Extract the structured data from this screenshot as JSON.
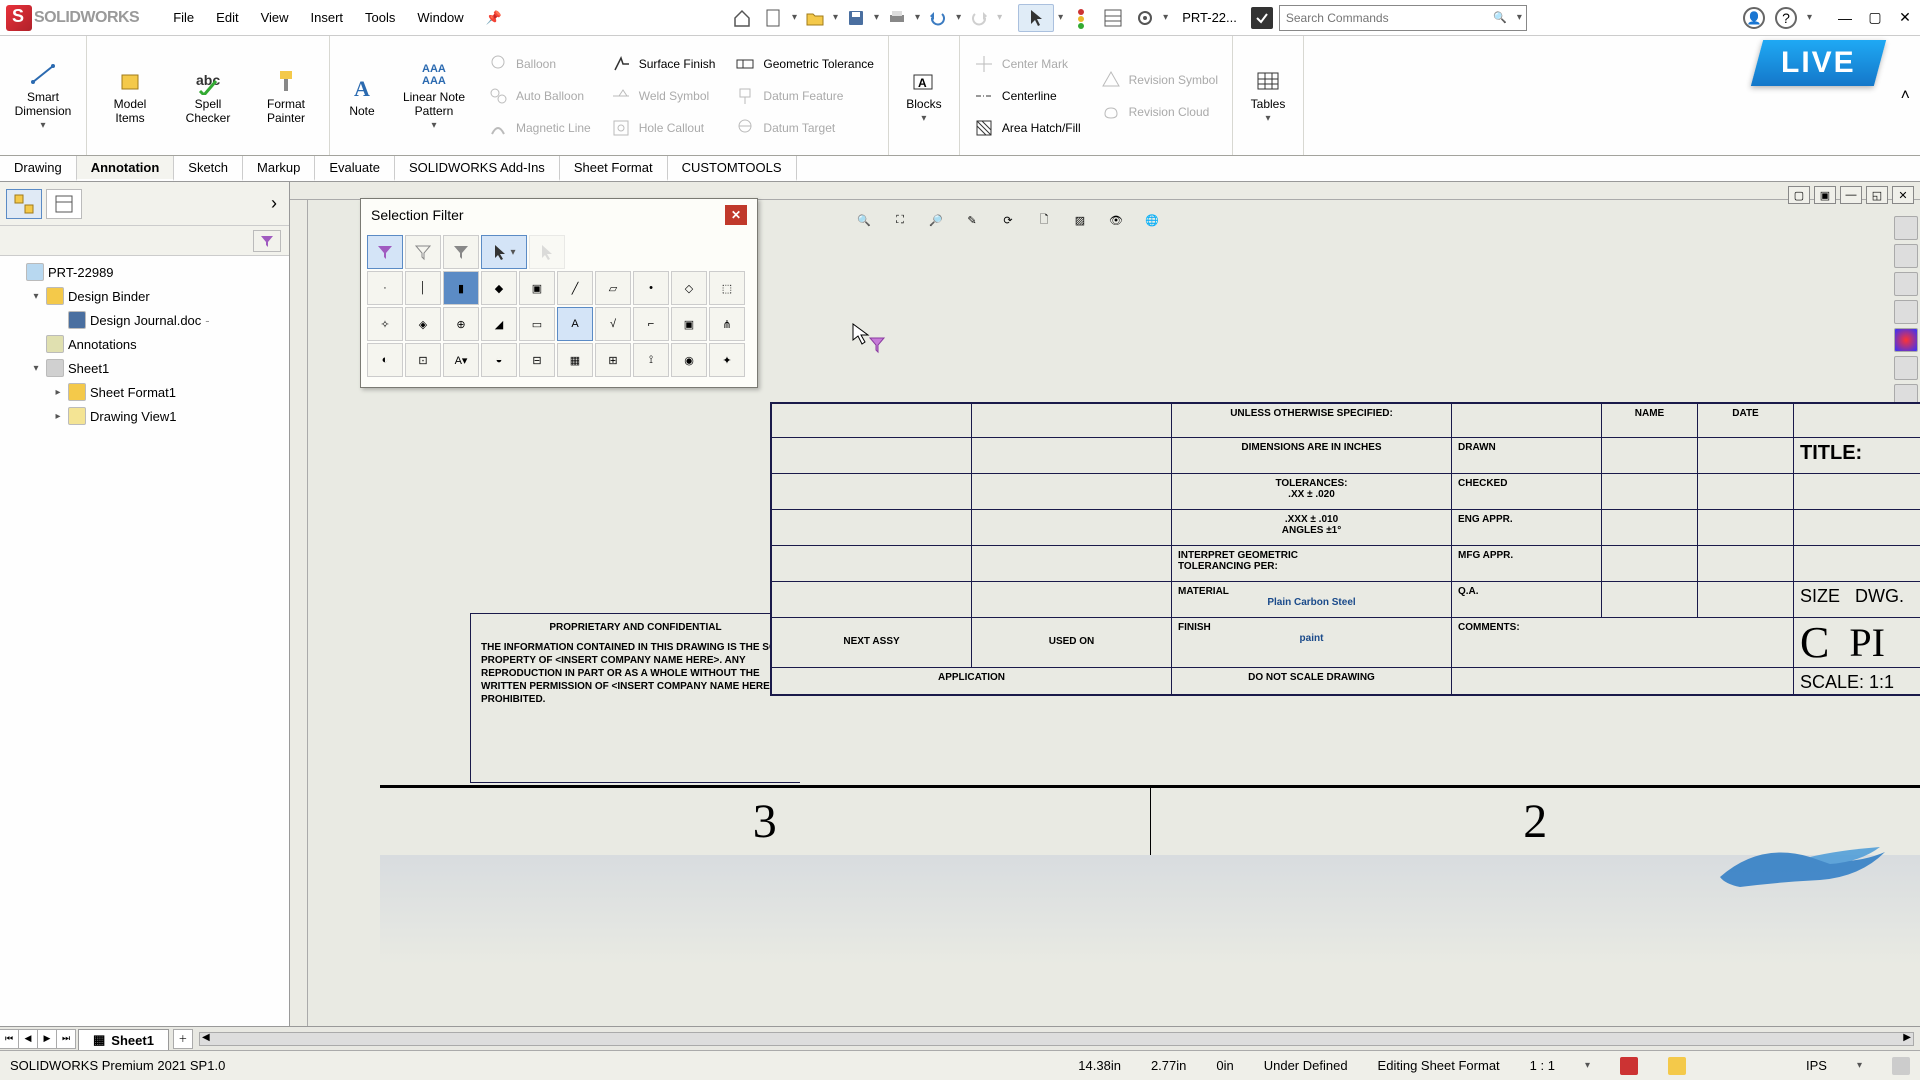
{
  "app": {
    "name": "SOLIDWORKS",
    "doc_title": "PRT-22..."
  },
  "menu": [
    "File",
    "Edit",
    "View",
    "Insert",
    "Tools",
    "Window"
  ],
  "search": {
    "placeholder": "Search Commands"
  },
  "ribbon_large": {
    "smart_dimension": "Smart\nDimension",
    "model_items": "Model\nItems",
    "spell_checker": "Spell\nChecker",
    "format_painter": "Format\nPainter",
    "note": "Note",
    "linear_note_pattern": "Linear Note\nPattern",
    "blocks": "Blocks",
    "tables": "Tables"
  },
  "ribbon_small": {
    "balloon": "Balloon",
    "auto_balloon": "Auto Balloon",
    "magnetic_line": "Magnetic Line",
    "surface_finish": "Surface Finish",
    "weld_symbol": "Weld Symbol",
    "hole_callout": "Hole Callout",
    "geo_tol": "Geometric Tolerance",
    "datum_feature": "Datum Feature",
    "datum_target": "Datum Target",
    "center_mark": "Center Mark",
    "centerline": "Centerline",
    "area_hatch": "Area Hatch/Fill",
    "revision_symbol": "Revision Symbol",
    "revision_cloud": "Revision Cloud"
  },
  "tabs": [
    "Drawing",
    "Annotation",
    "Sketch",
    "Markup",
    "Evaluate",
    "SOLIDWORKS Add-Ins",
    "Sheet Format",
    "CUSTOMTOOLS"
  ],
  "active_tab": "Annotation",
  "tree": {
    "root": "PRT-22989",
    "design_binder": "Design Binder",
    "design_journal": "Design Journal.doc",
    "annotations": "Annotations",
    "sheet": "Sheet1",
    "sheet_format": "Sheet Format1",
    "drawing_view": "Drawing View1"
  },
  "selection_filter": {
    "title": "Selection Filter"
  },
  "titleblock": {
    "header": "UNLESS OTHERWISE SPECIFIED:",
    "dim_in": "DIMENSIONS ARE IN INCHES",
    "tol": "TOLERANCES:",
    "xx": ".XX  ± .020",
    "xxx": ".XXX  ± .010",
    "angles": "ANGLES ±1°",
    "interpret": "INTERPRET GEOMETRIC\nTOLERANCING PER:",
    "material_lbl": "MATERIAL",
    "material_val": "Plain Carbon Steel",
    "finish_lbl": "FINISH",
    "finish_val": "paint",
    "next_assy": "NEXT ASSY",
    "used_on": "USED ON",
    "application": "APPLICATION",
    "no_scale": "DO NOT SCALE DRAWING",
    "name": "NAME",
    "date": "DATE",
    "drawn": "DRAWN",
    "checked": "CHECKED",
    "eng_appr": "ENG APPR.",
    "mfg_appr": "MFG APPR.",
    "qa": "Q.A.",
    "comments": "COMMENTS:",
    "title_lbl": "TITLE:",
    "size_lbl": "SIZE",
    "size_val": "C",
    "dwg": "DWG.",
    "dwg_pfx": "PI",
    "scale": "SCALE: 1:1"
  },
  "proprietary": {
    "head": "PROPRIETARY AND CONFIDENTIAL",
    "body": "THE INFORMATION CONTAINED IN THIS DRAWING IS THE SOLE PROPERTY OF <INSERT COMPANY NAME HERE>.  ANY REPRODUCTION IN PART OR AS A WHOLE WITHOUT THE WRITTEN PERMISSION OF <INSERT COMPANY NAME HERE> IS PROHIBITED."
  },
  "zones": {
    "a": "3",
    "b": "2"
  },
  "sheet_tab": "Sheet1",
  "status": {
    "product": "SOLIDWORKS Premium 2021 SP1.0",
    "x": "14.38in",
    "y": "2.77in",
    "z": "0in",
    "defined": "Under Defined",
    "mode": "Editing Sheet Format",
    "scale": "1 : 1",
    "units": "IPS"
  },
  "live": "LIVE"
}
